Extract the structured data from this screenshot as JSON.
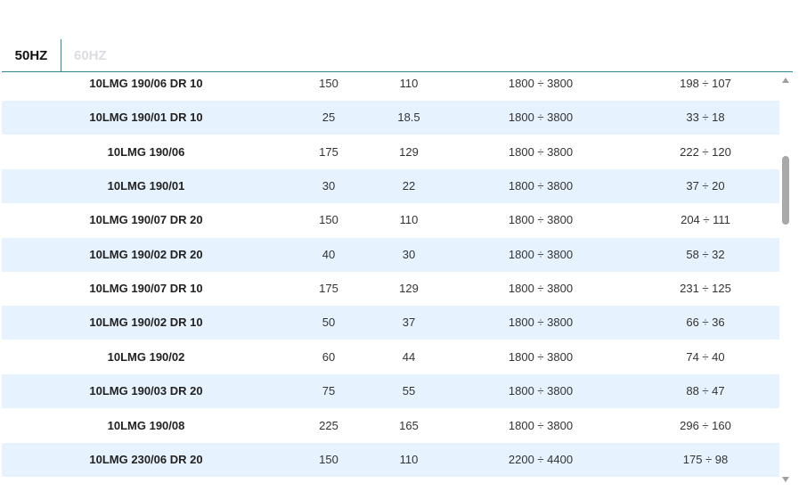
{
  "tabs": {
    "hz50": "50HZ",
    "hz60": "60HZ",
    "active": "50HZ"
  },
  "rows": [
    {
      "model": "10LMG 190/06 DR 10",
      "a": "150",
      "b": "110",
      "c": "1800 ÷ 3800",
      "d": "198 ÷ 107"
    },
    {
      "model": "10LMG 190/01 DR 10",
      "a": "25",
      "b": "18.5",
      "c": "1800 ÷ 3800",
      "d": "33 ÷ 18"
    },
    {
      "model": "10LMG 190/06",
      "a": "175",
      "b": "129",
      "c": "1800 ÷ 3800",
      "d": "222 ÷ 120"
    },
    {
      "model": "10LMG 190/01",
      "a": "30",
      "b": "22",
      "c": "1800 ÷ 3800",
      "d": "37 ÷ 20"
    },
    {
      "model": "10LMG 190/07 DR 20",
      "a": "150",
      "b": "110",
      "c": "1800 ÷ 3800",
      "d": "204 ÷ 111"
    },
    {
      "model": "10LMG 190/02 DR 20",
      "a": "40",
      "b": "30",
      "c": "1800 ÷ 3800",
      "d": "58 ÷ 32"
    },
    {
      "model": "10LMG 190/07 DR 10",
      "a": "175",
      "b": "129",
      "c": "1800 ÷ 3800",
      "d": "231 ÷ 125"
    },
    {
      "model": "10LMG 190/02 DR 10",
      "a": "50",
      "b": "37",
      "c": "1800 ÷ 3800",
      "d": "66 ÷ 36"
    },
    {
      "model": "10LMG 190/02",
      "a": "60",
      "b": "44",
      "c": "1800 ÷ 3800",
      "d": "74 ÷ 40"
    },
    {
      "model": "10LMG 190/03 DR 20",
      "a": "75",
      "b": "55",
      "c": "1800 ÷ 3800",
      "d": "88 ÷ 47"
    },
    {
      "model": "10LMG 190/08",
      "a": "225",
      "b": "165",
      "c": "1800 ÷ 3800",
      "d": "296 ÷ 160"
    },
    {
      "model": "10LMG 230/06 DR 20",
      "a": "150",
      "b": "110",
      "c": "2200 ÷ 4400",
      "d": "175 ÷ 98"
    }
  ],
  "colors": {
    "accent": "#2e8b93",
    "row_alt": "#e7f2ff",
    "tab_inactive": "#dcdde3",
    "scroll_thumb": "#a9a9a9"
  },
  "icons": {
    "scroll_up": "chevron-up-icon",
    "scroll_down": "chevron-down-icon"
  }
}
